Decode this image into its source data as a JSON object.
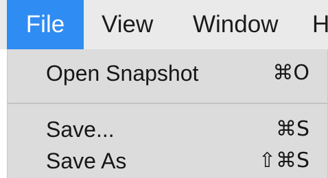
{
  "menubar": {
    "items": [
      {
        "label": "File",
        "active": true
      },
      {
        "label": "View",
        "active": false
      },
      {
        "label": "Window",
        "active": false
      },
      {
        "label": "H",
        "active": false
      }
    ],
    "active_color": "#2f8cf2"
  },
  "menu": {
    "groups": [
      [
        {
          "label": "Open Snapshot",
          "shortcut": "⌘O"
        }
      ],
      [
        {
          "label": "Save...",
          "shortcut": "⌘S"
        },
        {
          "label": "Save As",
          "shortcut": "⇧⌘S"
        }
      ]
    ]
  }
}
